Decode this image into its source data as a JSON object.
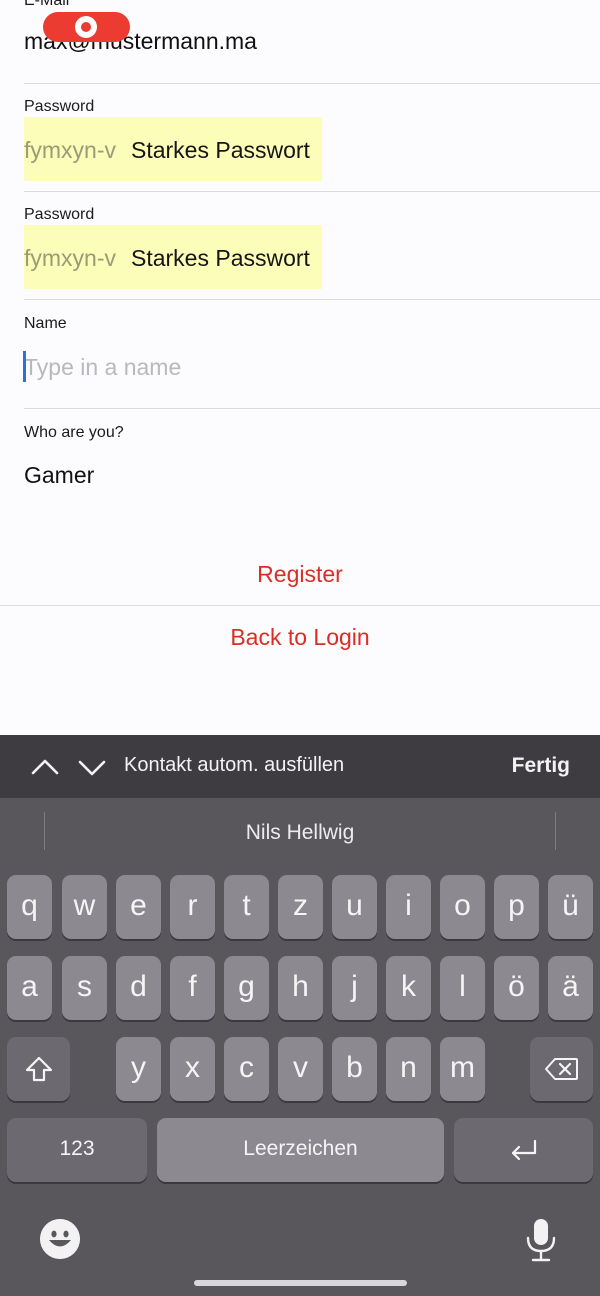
{
  "status": {
    "recording_indicator": "record-icon"
  },
  "form": {
    "email": {
      "label": "E-Mail",
      "value": "max@mustermann.ma"
    },
    "password": {
      "label": "Password",
      "generated": "fymxyn-v",
      "strong_label": "Starkes Passwort"
    },
    "password_confirm": {
      "label": "Password",
      "generated": "fymxyn-v",
      "strong_label": "Starkes Passwort"
    },
    "name": {
      "label": "Name",
      "placeholder": "Type in a name",
      "value": ""
    },
    "role": {
      "label": "Who are you?",
      "value": "Gamer"
    },
    "register_label": "Register",
    "back_label": "Back to Login"
  },
  "keyboard": {
    "toolbar": {
      "autofill_label": "Kontakt autom. ausfüllen",
      "done_label": "Fertig"
    },
    "suggestion": "Nils Hellwig",
    "rows": [
      [
        "q",
        "w",
        "e",
        "r",
        "t",
        "z",
        "u",
        "i",
        "o",
        "p",
        "ü"
      ],
      [
        "a",
        "s",
        "d",
        "f",
        "g",
        "h",
        "j",
        "k",
        "l",
        "ö",
        "ä"
      ],
      [
        "y",
        "x",
        "c",
        "v",
        "b",
        "n",
        "m"
      ]
    ],
    "numbers_label": "123",
    "space_label": "Leerzeichen",
    "icons": [
      "shift-icon",
      "delete-icon",
      "return-icon",
      "emoji-icon",
      "microphone-icon",
      "chevron-up-icon",
      "chevron-down-icon"
    ]
  },
  "colors": {
    "accent": "#dc2d24",
    "autofill_highlight": "#fbfdb9",
    "keyboard_bg": "#59565c",
    "key_bg": "#8c8a90"
  }
}
